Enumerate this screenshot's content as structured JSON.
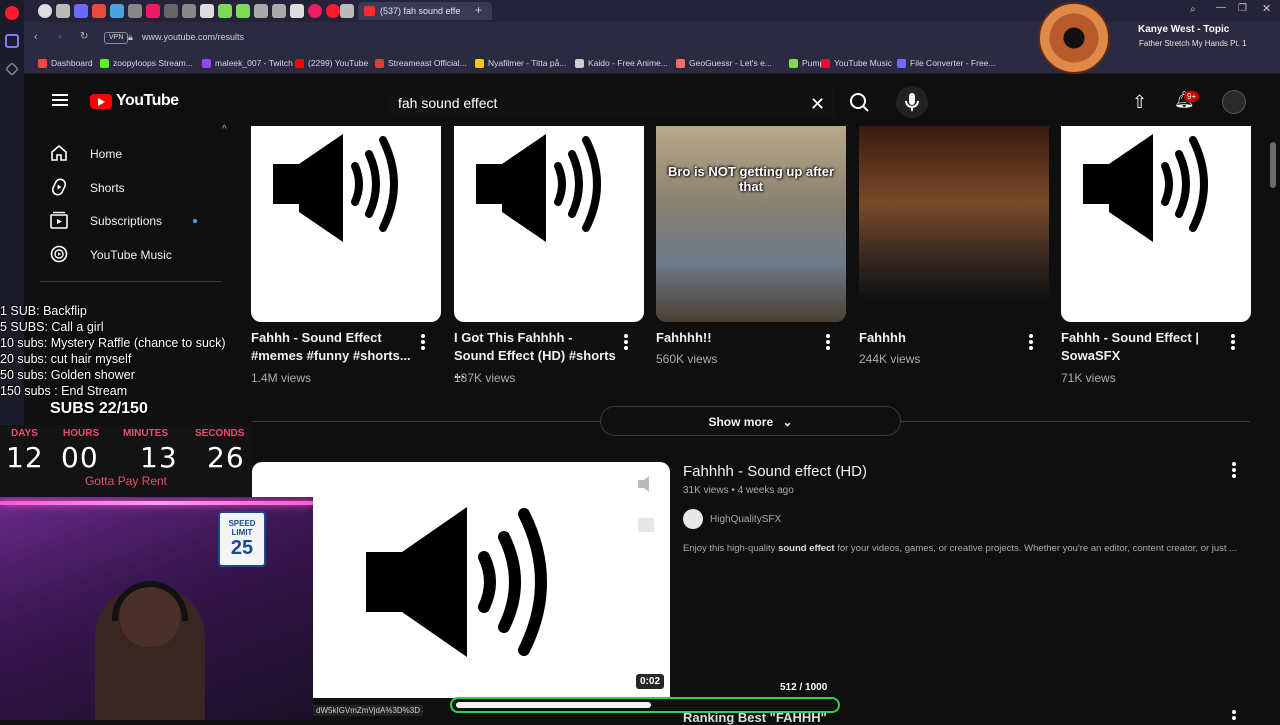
{
  "browser": {
    "active_tab_label": "(537) fah sound effe",
    "vpn_label": "VPN",
    "url": "www.youtube.com/results",
    "bookmarks": [
      {
        "label": "Dashboard",
        "color": "#ff4444"
      },
      {
        "label": "zoopyloops Stream...",
        "color": "#53fc18"
      },
      {
        "label": "maleek_007 - Twitch",
        "color": "#9146ff"
      },
      {
        "label": "(2299) YouTube",
        "color": "#ff0000"
      },
      {
        "label": "Streameast Official...",
        "color": "#e53935"
      },
      {
        "label": "Nyafilmer - Titta på...",
        "color": "#f6c90e"
      },
      {
        "label": "Kaido - Free Anime...",
        "color": "#cccccc"
      },
      {
        "label": "GeoGuessr - Let's e...",
        "color": "#ff6f61"
      },
      {
        "label": "Pump",
        "color": "#7ed957"
      },
      {
        "label": "YouTube Music",
        "color": "#ff0033"
      },
      {
        "label": "File Converter - Free...",
        "color": "#6c6cff"
      }
    ]
  },
  "now_playing": {
    "title": "Kanye West - Topic",
    "subtitle": "Father Stretch My Hands Pt. 1"
  },
  "header": {
    "logo_text": "YouTube",
    "search_value": "fah sound effect",
    "notification_badge": "9+"
  },
  "sidebar": {
    "items": [
      {
        "label": "Home",
        "icon": "home-icon"
      },
      {
        "label": "Shorts",
        "icon": "shorts-icon"
      },
      {
        "label": "Subscriptions",
        "icon": "subscriptions-icon"
      },
      {
        "label": "YouTube Music",
        "icon": "youtube-music-icon"
      }
    ]
  },
  "shorts": [
    {
      "title": "Fahhh - Sound Effect #memes #funny #shorts...",
      "views": "1.4M views",
      "thumb": "speaker"
    },
    {
      "title": "I Got This Fahhhh - Sound Effect (HD) #shorts ...",
      "views": "187K views",
      "thumb": "speaker"
    },
    {
      "title": "Fahhhh!!",
      "views": "560K views",
      "thumb": "photo",
      "caption": "Bro is NOT getting up after that"
    },
    {
      "title": "Fahhhh",
      "views": "244K views",
      "thumb": "game"
    },
    {
      "title": "Fahhh - Sound Effect | SowaSFX",
      "views": "71K views",
      "thumb": "speaker"
    }
  ],
  "show_more_label": "Show more",
  "video": {
    "title": "Fahhhh - Sound effect (HD)",
    "meta": "31K views • 4 weeks ago",
    "channel": "HighQualitySFX",
    "desc_pre": "Enjoy this high-quality ",
    "desc_bold": "sound effect",
    "desc_post": " for your videos, games, or creative projects. Whether you're an editor, content creator, or just ...",
    "duration": "0:02",
    "next_title": "Ranking Best \"FAHHH\""
  },
  "stream": {
    "goals": [
      "1 SUB: Backflip",
      "5 SUBS: Call a girl",
      "10 subs: Mystery Raffle (chance to suck)",
      "20 subs: cut hair myself",
      "50 subs: Golden shower",
      "150 subs : End Stream"
    ],
    "subs_label": "SUBS 22/150",
    "countdown": {
      "labels": [
        "DAYS",
        "HOURS",
        "MINUTES",
        "SECONDS"
      ],
      "values": [
        "12",
        "00",
        "13",
        "26"
      ],
      "caption": "Gotta Pay Rent"
    },
    "sign_top": "SPEED LIMIT",
    "sign_value": "25",
    "url_hint": "dW5kIGVmZmVjdA%3D%3D",
    "progress_text": "512  / 1000",
    "progress_fraction": 0.512
  }
}
